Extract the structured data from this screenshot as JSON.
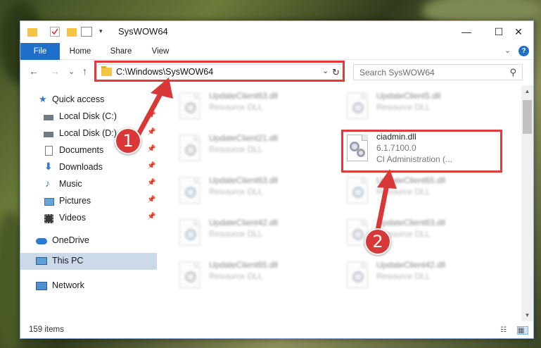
{
  "window": {
    "title": "SysWOW64",
    "minimize_label": "—",
    "maximize_label": "☐",
    "close_label": "✕"
  },
  "ribbon": {
    "tabs": [
      {
        "label": "File",
        "active": true
      },
      {
        "label": "Home"
      },
      {
        "label": "Share"
      },
      {
        "label": "View"
      }
    ],
    "expand_glyph": "⌄",
    "help_glyph": "?"
  },
  "address": {
    "back_glyph": "←",
    "forward_glyph": "→",
    "recent_glyph": "⌄",
    "up_glyph": "↑",
    "path": "C:\\Windows\\SysWOW64",
    "dropdown_glyph": "⌄",
    "refresh_glyph": "↻"
  },
  "search": {
    "placeholder": "Search SysWOW64",
    "icon_glyph": "⚲"
  },
  "nav": {
    "quick_access": "Quick access",
    "items": [
      {
        "label": "Local Disk (C:)",
        "pinned": true,
        "icon": "drive-icon"
      },
      {
        "label": "Local Disk (D:)",
        "pinned": true,
        "icon": "drive-icon"
      },
      {
        "label": "Documents",
        "pinned": true,
        "icon": "documents-icon"
      },
      {
        "label": "Downloads",
        "pinned": true,
        "icon": "downloads-icon"
      },
      {
        "label": "Music",
        "pinned": true,
        "icon": "music-icon"
      },
      {
        "label": "Pictures",
        "pinned": true,
        "icon": "pictures-icon"
      },
      {
        "label": "Videos",
        "pinned": true,
        "icon": "videos-icon"
      }
    ],
    "onedrive": "OneDrive",
    "this_pc": "This PC",
    "network": "Network",
    "pin_glyph": "📌"
  },
  "files": [
    {
      "name": "UpdateClient63.dll",
      "desc": "Resource DLL",
      "blurred": true
    },
    {
      "name": "UpdateClient5.dll",
      "desc": "Resource DLL",
      "blurred": true
    },
    {
      "name": "UpdateClient21.dll",
      "desc": "Resource DLL",
      "blurred": true
    },
    {
      "name": "ciadmin.dll",
      "version": "6.1.7100.0",
      "desc": "CI Administration (...",
      "blurred": false
    },
    {
      "name": "UpdateClient63.dll",
      "desc": "Resource DLL",
      "blurred": true
    },
    {
      "name": "UpdateClient65.dll",
      "desc": "Resource DLL",
      "blurred": true
    },
    {
      "name": "UpdateClient42.dll",
      "desc": "Resource DLL",
      "blurred": true
    },
    {
      "name": "UpdateClient63.dll",
      "desc": "Resource DLL",
      "blurred": true
    },
    {
      "name": "UpdateClient65.dll",
      "desc": "Resource DLL",
      "blurred": true
    },
    {
      "name": "UpdateClient42.dll",
      "desc": "Resource DLL",
      "blurred": true
    }
  ],
  "scrollbar": {
    "up_glyph": "▲",
    "down_glyph": "▼"
  },
  "status": {
    "item_count": "159 items"
  },
  "annotations": {
    "step1": "1",
    "step2": "2",
    "color": "#d93838"
  }
}
